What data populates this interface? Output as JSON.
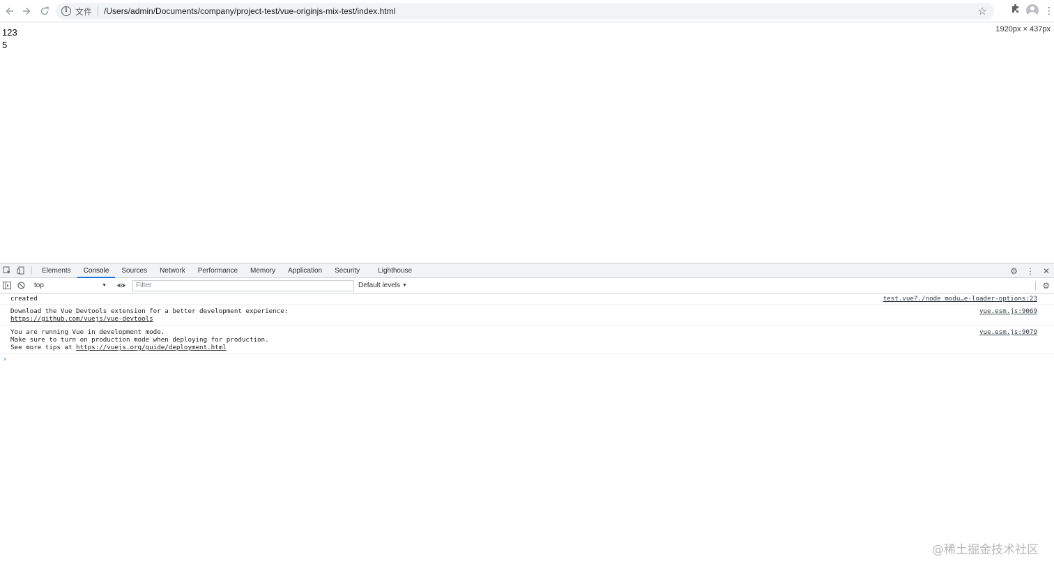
{
  "browser": {
    "scheme_label": "文件",
    "url": "/Users/admin/Documents/company/project-test/vue-originjs-mix-test/index.html"
  },
  "page": {
    "lines": [
      "123",
      "5"
    ],
    "dimensions_overlay": "1920px × 437px"
  },
  "devtools": {
    "tabs": [
      "Elements",
      "Console",
      "Sources",
      "Network",
      "Performance",
      "Memory",
      "Application",
      "Security",
      "Lighthouse"
    ],
    "active_tab": "Console",
    "console": {
      "context": "top",
      "filter_placeholder": "Filter",
      "levels_label": "Default levels",
      "messages": [
        {
          "lines": [
            "created"
          ],
          "source": "test.vue?./node_modu…e-loader-options:23"
        },
        {
          "lines": [
            "Download the Vue Devtools extension for a better development experience:"
          ],
          "link": "https://github.com/vuejs/vue-devtools",
          "source": "vue.esm.js:9069"
        },
        {
          "lines": [
            "You are running Vue in development mode.",
            "Make sure to turn on production mode when deploying for production."
          ],
          "tips_prefix": "See more tips at ",
          "link": "https://vuejs.org/guide/deployment.html",
          "source": "vue.esm.js:9079"
        }
      ],
      "prompt_symbol": "›"
    }
  },
  "watermark": "@稀土掘金技术社区"
}
